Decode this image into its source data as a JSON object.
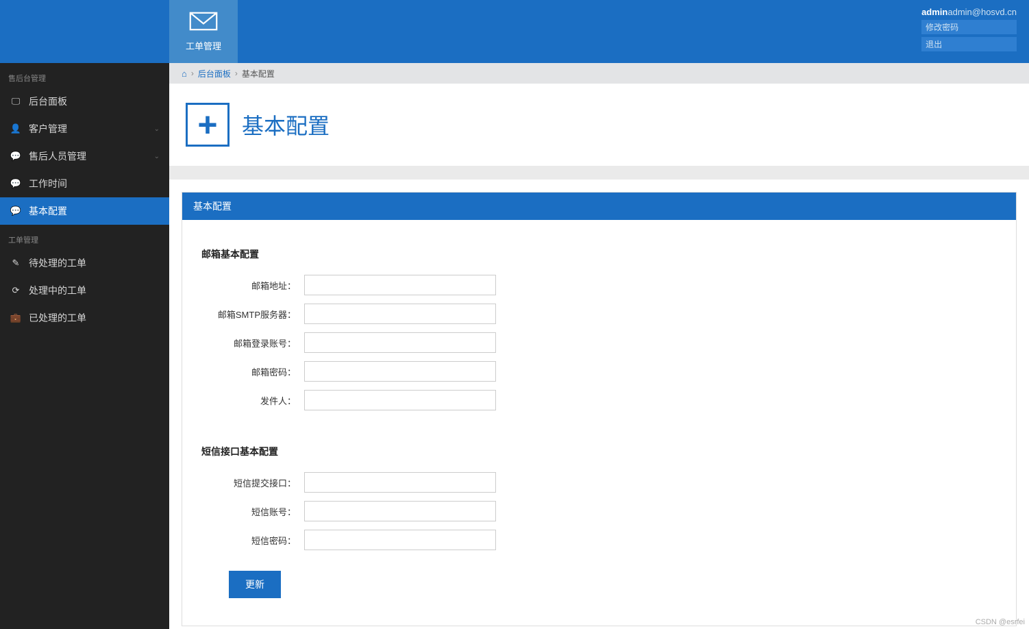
{
  "topbar": {
    "module_label": "工单管理",
    "user": {
      "name": "admin",
      "email": "admin@hosvd.cn"
    },
    "links": {
      "change_pw": "修改密码",
      "logout": "退出"
    }
  },
  "sidebar": {
    "group1_title": "售后台管理",
    "group2_title": "工单管理",
    "items": [
      {
        "icon": "desktop",
        "label": "后台面板",
        "has_sub": false
      },
      {
        "icon": "user",
        "label": "客户管理",
        "has_sub": true
      },
      {
        "icon": "chat",
        "label": "售后人员管理",
        "has_sub": true
      },
      {
        "icon": "chat",
        "label": "工作时间",
        "has_sub": false
      },
      {
        "icon": "chat",
        "label": "基本配置",
        "has_sub": false,
        "active": true
      }
    ],
    "items2": [
      {
        "icon": "pencil",
        "label": "待处理的工单"
      },
      {
        "icon": "refresh",
        "label": "处理中的工单"
      },
      {
        "icon": "briefcase",
        "label": "已处理的工单"
      }
    ]
  },
  "breadcrumb": {
    "link1": "后台面板",
    "current": "基本配置"
  },
  "page": {
    "title": "基本配置",
    "panel_title": "基本配置",
    "section1": "邮箱基本配置",
    "section2": "短信接口基本配置",
    "fields": {
      "email_addr": "邮箱地址：",
      "smtp": "邮箱SMTP服务器：",
      "login": "邮箱登录账号：",
      "password": "邮箱密码：",
      "sender": "发件人：",
      "sms_api": "短信提交接口：",
      "sms_account": "短信账号：",
      "sms_pw": "短信密码："
    },
    "submit": "更新"
  },
  "watermark": "CSDN @esrfei"
}
